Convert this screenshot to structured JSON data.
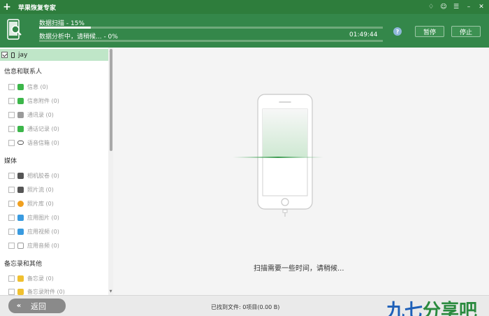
{
  "app": {
    "title": "苹果恢复专家",
    "logo_glyph": "+",
    "win_buttons": [
      "♢",
      "☺",
      "☰",
      "–",
      "✕"
    ]
  },
  "progress": {
    "scan_label": "数据扫描 - 15%",
    "scan_percent": 15,
    "analyze_label": "数据分析中，请稍候... - 0%",
    "analyze_percent": 0,
    "timer": "01:49:44",
    "help_glyph": "?",
    "pause_label": "暂停",
    "stop_label": "停止"
  },
  "sidebar": {
    "device": {
      "name": "jay",
      "checked": true
    },
    "categories": [
      {
        "title": "信息和联系人",
        "items": [
          {
            "label": "信息 (0)",
            "icon": "message-icon",
            "color": "#3cb64a"
          },
          {
            "label": "信息附件 (0)",
            "icon": "message-attachment-icon",
            "color": "#3cb64a"
          },
          {
            "label": "通讯录 (0)",
            "icon": "contacts-icon",
            "color": "#9a9a9a"
          },
          {
            "label": "通话记录 (0)",
            "icon": "phone-call-icon",
            "color": "#3cb64a"
          },
          {
            "label": "语音信箱 (0)",
            "icon": "voicemail-icon",
            "color": "#555555"
          }
        ]
      },
      {
        "title": "媒体",
        "items": [
          {
            "label": "相机胶卷 (0)",
            "icon": "camera-icon",
            "color": "#555555"
          },
          {
            "label": "照片流 (0)",
            "icon": "photostream-icon",
            "color": "#555555"
          },
          {
            "label": "照片库 (0)",
            "icon": "photo-library-icon",
            "color": "#f0a020"
          },
          {
            "label": "应用图片 (0)",
            "icon": "app-photo-icon",
            "color": "#3a9be0"
          },
          {
            "label": "应用视频 (0)",
            "icon": "app-video-icon",
            "color": "#3a9be0"
          },
          {
            "label": "应用音频 (0)",
            "icon": "app-audio-icon",
            "color": "#9a9a9a"
          }
        ]
      },
      {
        "title": "备忘录和其他",
        "items": [
          {
            "label": "备忘录 (0)",
            "icon": "notes-icon",
            "color": "#f0c030"
          },
          {
            "label": "备忘录附件 (0)",
            "icon": "notes-attachment-icon",
            "color": "#f0c030"
          }
        ]
      }
    ]
  },
  "main": {
    "scan_message": "扫描需要一些时间，请稍候..."
  },
  "footer": {
    "back_label": "返回",
    "back_glyph": "«",
    "found_text": "已找到文件: 0项目(0.00 B)",
    "watermark_a": "九七",
    "watermark_b": "分享吧"
  }
}
